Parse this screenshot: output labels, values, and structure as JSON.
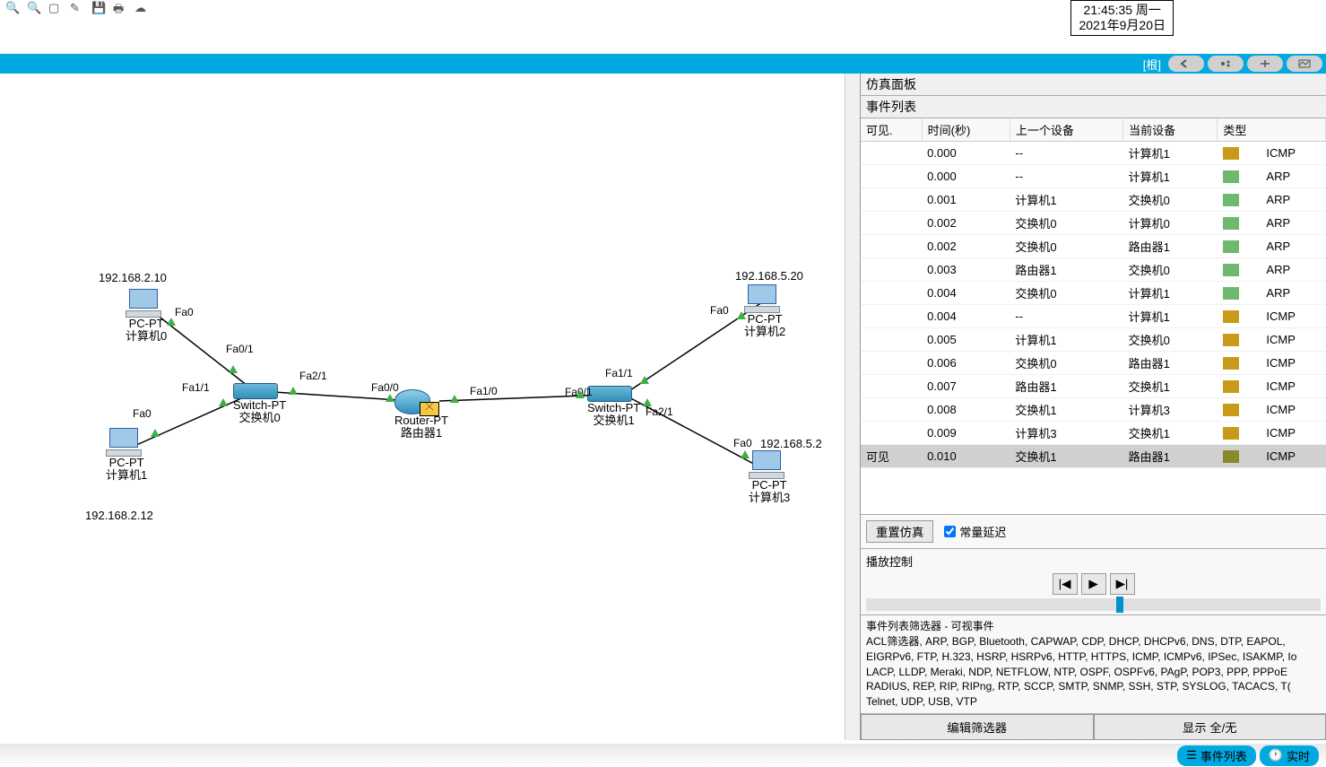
{
  "datetime": {
    "time": "21:45:35 周一",
    "date": "2021年9月20日"
  },
  "bluebar": {
    "root": "[根]"
  },
  "simpanel": {
    "title": "仿真面板",
    "event_list_title": "事件列表",
    "headers": {
      "visible": "可见.",
      "time": "时间(秒)",
      "prev": "上一个设备",
      "curr": "当前设备",
      "type": "类型"
    },
    "rows": [
      {
        "time": "0.000",
        "prev": "--",
        "curr": "计算机1",
        "type": "ICMP",
        "color": "#c99a1a"
      },
      {
        "time": "0.000",
        "prev": "--",
        "curr": "计算机1",
        "type": "ARP",
        "color": "#6fb86f"
      },
      {
        "time": "0.001",
        "prev": "计算机1",
        "curr": "交换机0",
        "type": "ARP",
        "color": "#6fb86f"
      },
      {
        "time": "0.002",
        "prev": "交换机0",
        "curr": "计算机0",
        "type": "ARP",
        "color": "#6fb86f"
      },
      {
        "time": "0.002",
        "prev": "交换机0",
        "curr": "路由器1",
        "type": "ARP",
        "color": "#6fb86f"
      },
      {
        "time": "0.003",
        "prev": "路由器1",
        "curr": "交换机0",
        "type": "ARP",
        "color": "#6fb86f"
      },
      {
        "time": "0.004",
        "prev": "交换机0",
        "curr": "计算机1",
        "type": "ARP",
        "color": "#6fb86f"
      },
      {
        "time": "0.004",
        "prev": "--",
        "curr": "计算机1",
        "type": "ICMP",
        "color": "#c99a1a"
      },
      {
        "time": "0.005",
        "prev": "计算机1",
        "curr": "交换机0",
        "type": "ICMP",
        "color": "#c99a1a"
      },
      {
        "time": "0.006",
        "prev": "交换机0",
        "curr": "路由器1",
        "type": "ICMP",
        "color": "#c99a1a"
      },
      {
        "time": "0.007",
        "prev": "路由器1",
        "curr": "交换机1",
        "type": "ICMP",
        "color": "#c99a1a"
      },
      {
        "time": "0.008",
        "prev": "交换机1",
        "curr": "计算机3",
        "type": "ICMP",
        "color": "#c99a1a"
      },
      {
        "time": "0.009",
        "prev": "计算机3",
        "curr": "交换机1",
        "type": "ICMP",
        "color": "#c99a1a"
      },
      {
        "time": "0.010",
        "prev": "交换机1",
        "curr": "路由器1",
        "type": "ICMP",
        "color": "#8a8a2a",
        "selected": true,
        "visible_label": "可见"
      }
    ],
    "reset": "重置仿真",
    "constant_delay": "常量延迟",
    "play_title": "播放控制",
    "filters_title": "事件列表筛选器 - 可视事件",
    "filters_text": "ACL筛选器, ARP, BGP, Bluetooth, CAPWAP, CDP, DHCP, DHCPv6, DNS, DTP, EAPOL, EIGRPv6, FTP, H.323, HSRP, HSRPv6, HTTP, HTTPS, ICMP, ICMPv6, IPSec, ISAKMP, Io LACP, LLDP, Meraki, NDP, NETFLOW, NTP, OSPF, OSPFv6, PAgP, POP3, PPP, PPPoE RADIUS, REP, RIP, RIPng, RTP, SCCP, SMTP, SNMP, SSH, STP, SYSLOG, TACACS, T( Telnet, UDP, USB, VTP",
    "edit_filters": "编辑筛选器",
    "show_all_none": "显示 全/无"
  },
  "topology": {
    "pc0": {
      "type": "PC-PT",
      "name": "计算机0",
      "ip": "192.168.2.10",
      "port": "Fa0"
    },
    "pc1": {
      "type": "PC-PT",
      "name": "计算机1",
      "ip": "192.168.2.12",
      "port": "Fa0"
    },
    "pc2": {
      "type": "PC-PT",
      "name": "计算机2",
      "ip": "192.168.5.20",
      "port": "Fa0"
    },
    "pc3": {
      "type": "PC-PT",
      "name": "计算机3",
      "ip": "192.168.5.2",
      "port": "Fa0"
    },
    "sw0": {
      "type": "Switch-PT",
      "name": "交换机0"
    },
    "sw1": {
      "type": "Switch-PT",
      "name": "交换机1"
    },
    "rt1": {
      "type": "Router-PT",
      "name": "路由器1"
    },
    "ports": {
      "sw0_fa01": "Fa0/1",
      "sw0_fa11": "Fa1/1",
      "sw0_fa21": "Fa2/1",
      "rt_fa00": "Fa0/0",
      "rt_fa10": "Fa1/0",
      "sw1_fa01": "Fa0/1",
      "sw1_fa11": "Fa1/1",
      "sw1_fa21": "Fa2/1"
    }
  },
  "bottombar": {
    "event_list": "事件列表",
    "realtime": "实时"
  }
}
